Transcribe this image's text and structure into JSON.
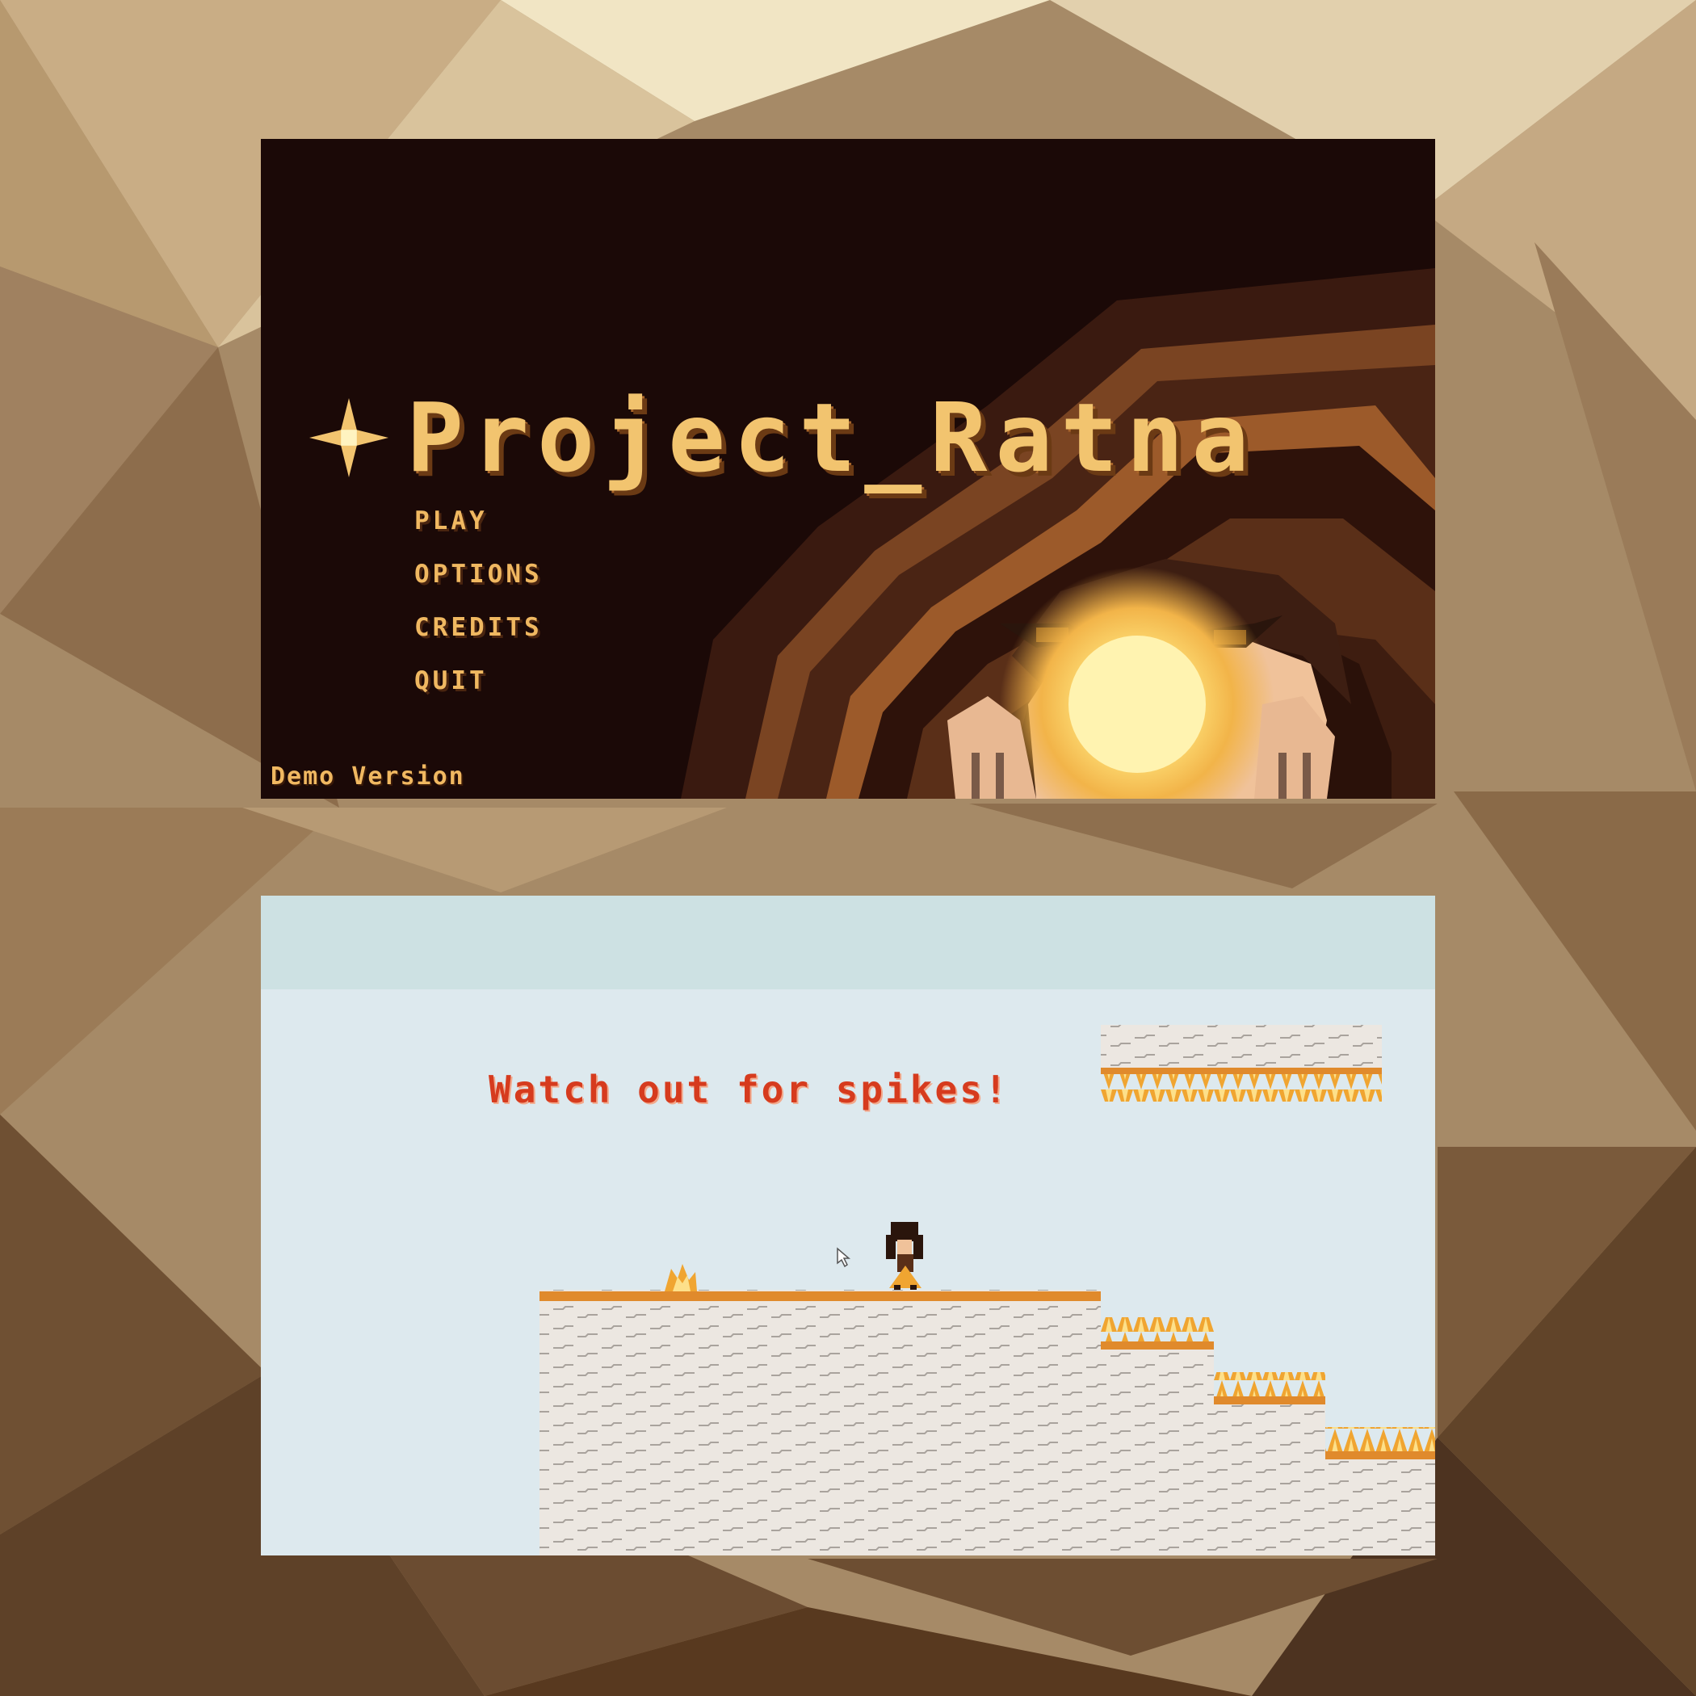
{
  "title_screen": {
    "game_title": "Project_Ratna",
    "menu": [
      "PLAY",
      "OPTIONS",
      "CREDITS",
      "QUIT"
    ],
    "demo_label": "Demo Version"
  },
  "gameplay_screen": {
    "hint_text": "Watch out for spikes!"
  },
  "colors": {
    "title_gold": "#f2c46f",
    "menu_gold": "#f0b861",
    "hint_red": "#d63b1e",
    "sky": "#dde9ee",
    "platform_orange": "#e08a2c"
  }
}
